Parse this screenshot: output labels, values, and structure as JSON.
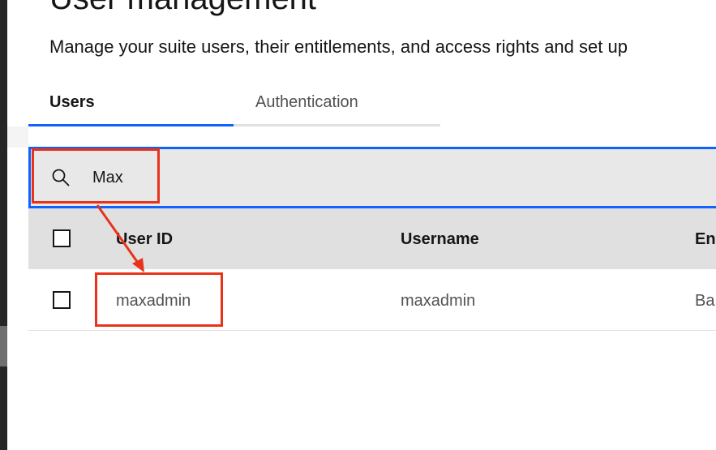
{
  "page": {
    "title": "User management",
    "subtitle": "Manage your suite users, their entitlements, and access rights and set up"
  },
  "tabs": [
    {
      "label": "Users",
      "selected": true
    },
    {
      "label": "Authentication",
      "selected": false
    }
  ],
  "search": {
    "value": "Max",
    "icon": "search-icon"
  },
  "table": {
    "columns": [
      "User ID",
      "Username",
      "En"
    ],
    "rows": [
      {
        "user_id": "maxadmin",
        "username": "maxadmin",
        "email": "Ba"
      }
    ]
  },
  "annotation": {
    "color": "#e8321a"
  },
  "colors": {
    "accent": "#0f62fe",
    "header_bg": "#e0e0e0",
    "search_bg": "#e8e8e8"
  }
}
